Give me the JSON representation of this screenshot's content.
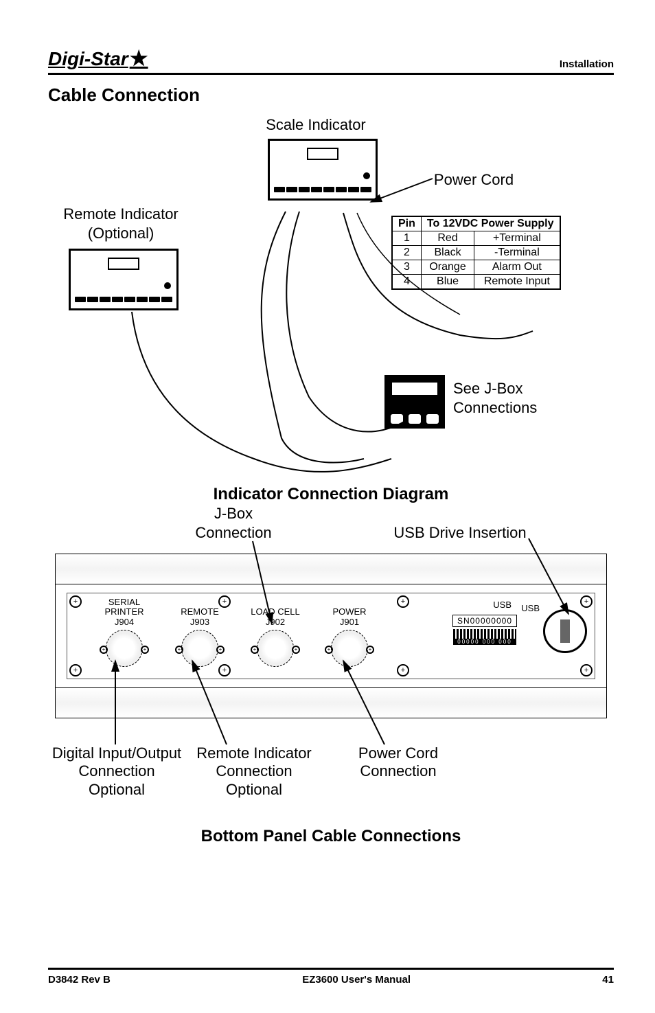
{
  "header": {
    "brand": "Digi-Star",
    "section": "Installation"
  },
  "title": "Cable Connection",
  "d1": {
    "scale_indicator": "Scale Indicator",
    "power_cord": "Power Cord",
    "remote_indicator": "Remote Indicator",
    "optional": "(Optional)",
    "see_jbox": "See J-Box",
    "connections": "Connections",
    "pin_table": {
      "h_pin": "Pin",
      "h_desc": "To 12VDC Power Supply",
      "rows": [
        {
          "pin": "1",
          "color": "Red",
          "func": "+Terminal"
        },
        {
          "pin": "2",
          "color": "Black",
          "func": "-Terminal"
        },
        {
          "pin": "3",
          "color": "Orange",
          "func": "Alarm Out"
        },
        {
          "pin": "4",
          "color": "Blue",
          "func": "Remote Input"
        }
      ]
    }
  },
  "d1_title": "Indicator Connection Diagram",
  "d2": {
    "jbox_conn_a": "J-Box",
    "jbox_conn_b": "Connection",
    "usb_drive": "USB Drive Insertion",
    "ports": {
      "serial": {
        "l1": "SERIAL",
        "l2": "PRINTER",
        "l3": "J904"
      },
      "remote": {
        "l1": "REMOTE",
        "l2": "J903"
      },
      "loadcell": {
        "l1": "LOAD CELL",
        "l2": "J902"
      },
      "power": {
        "l1": "POWER",
        "l2": "J901"
      }
    },
    "usb_label": "USB",
    "sn": "SN00000000",
    "callouts": {
      "dio_a": "Digital Input/Output",
      "dio_b": "Connection",
      "dio_c": "Optional",
      "rem_a": "Remote Indicator",
      "rem_b": "Connection",
      "rem_c": "Optional",
      "pwr_a": "Power Cord",
      "pwr_b": "Connection"
    }
  },
  "d2_title": "Bottom Panel Cable Connections",
  "footer": {
    "left": "D3842 Rev B",
    "center": "EZ3600 User's Manual",
    "right": "41"
  }
}
